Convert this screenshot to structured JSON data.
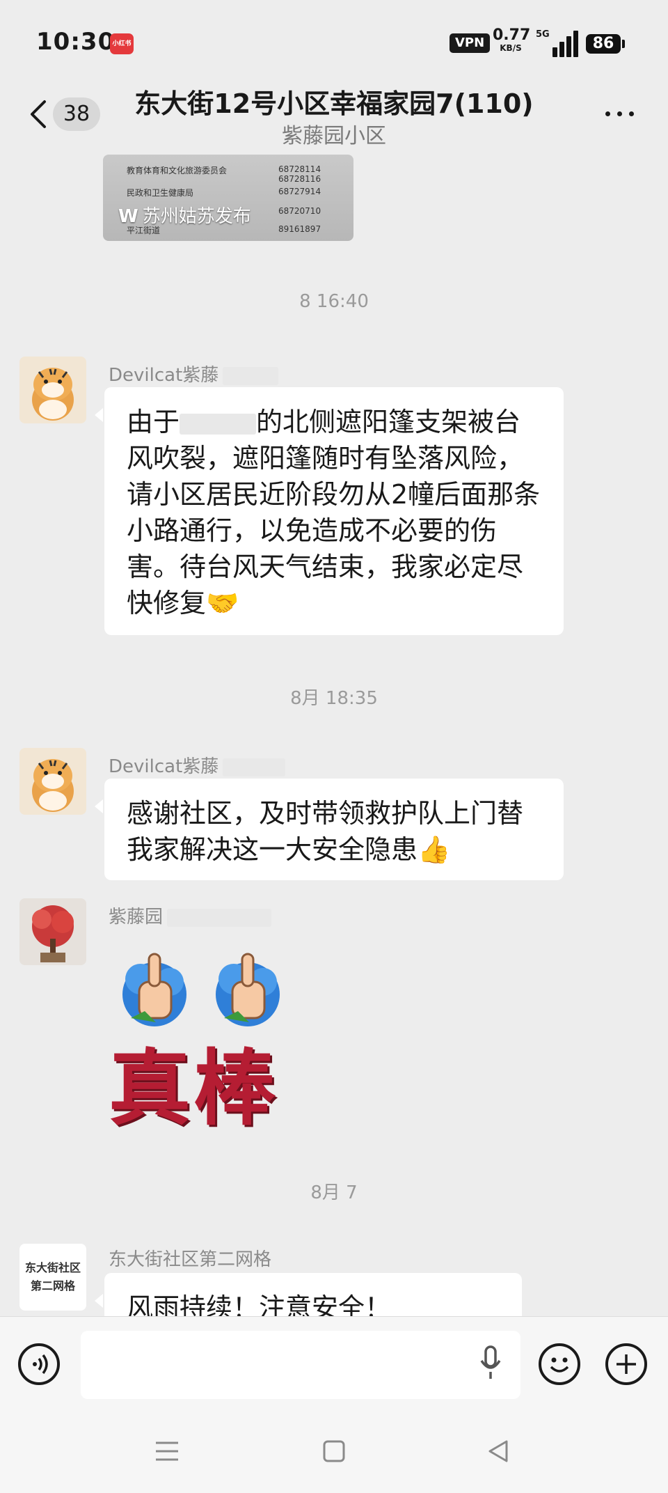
{
  "status_bar": {
    "time": "10:30",
    "app_badge": "小红书",
    "vpn": "VPN",
    "speed_value": "0.77",
    "speed_unit": "KB/S",
    "network": "5G",
    "battery": "86"
  },
  "header": {
    "unread_count": "38",
    "title": "东大街12号小区幸福家园7(110)",
    "subtitle": "紫藤园小区"
  },
  "messages": {
    "image_card": {
      "rows": [
        {
          "name": "教育体育和文化旅游委员会",
          "phone": "68728114 68728116"
        },
        {
          "name": "民政和卫生健康局",
          "phone": "68727914"
        },
        {
          "name": "",
          "phone": "68720710"
        },
        {
          "name": "平江街道",
          "phone": "89161897"
        }
      ],
      "caption": "苏州姑苏发布"
    },
    "ts1": "8  16:40",
    "msg1": {
      "sender": "Devilcat紫藤",
      "text_prefix": "由于",
      "text_body": "的北侧遮阳篷支架被台风吹裂，遮阳篷随时有坠落风险，请小区居民近阶段勿从2幢后面那条小路通行，以免造成不必要的伤害。待台风天气结束，我家必定尽快修复🤝"
    },
    "ts2": "8月  18:35",
    "msg2": {
      "sender": "Devilcat紫藤",
      "text": "感谢社区，及时带领救护队上门替我家解决这一大安全隐患👍"
    },
    "msg3": {
      "sender": "紫藤园",
      "sticker_text": "真棒"
    },
    "ts3": "8月   7",
    "msg4": {
      "sender": "东大街社区第二网格",
      "avatar_text": "东大街社区 第二网格",
      "text": "风雨持续！注意安全！"
    }
  },
  "colors": {
    "background": "#ededed",
    "bubble": "#ffffff",
    "sticker_red": "#b51d33",
    "sticker_blue": "#2f7fd8"
  }
}
